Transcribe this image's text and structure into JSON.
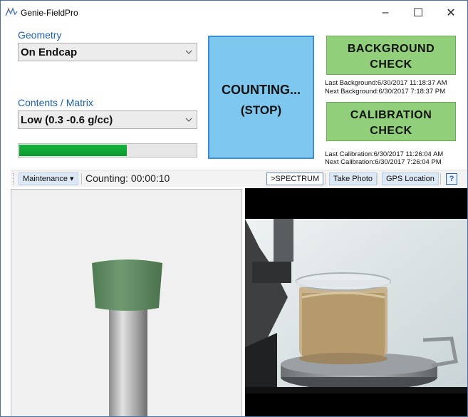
{
  "window": {
    "title": "Genie-FieldPro",
    "controls": {
      "minimize": "–",
      "maximize": "☐",
      "close": "✕"
    }
  },
  "left_controls": {
    "geometry_label": "Geometry",
    "geometry_value": "On Endcap",
    "contents_label": "Contents / Matrix",
    "contents_value": "Low (0.3 -0.6 g/cc)",
    "progress_fraction": 0.61
  },
  "counting_button": {
    "line1": "COUNTING...",
    "line2": "(STOP)"
  },
  "background_check": {
    "line1": "BACKGROUND",
    "line2": "CHECK",
    "last": "Last Background:6/30/2017 11:18:37 AM",
    "next": "Next Background:6/30/2017 7:18:37 PM"
  },
  "calibration_check": {
    "line1": "CALIBRATION",
    "line2": "CHECK",
    "last": "Last Calibration:6/30/2017 11:26:04 AM",
    "next": "Next Calibration:6/30/2017 7:26:04 PM"
  },
  "toolbar": {
    "maintenance": "Maintenance ▾",
    "counting_status": "Counting: 00:00:10",
    "spectrum": ">SPECTRUM",
    "take_photo": "Take Photo",
    "gps_location": "GPS Location",
    "help": "?"
  },
  "colors": {
    "counting_bg": "#7ec7ef",
    "check_bg": "#91cf7a",
    "progress": "#17b33e",
    "label_blue": "#1f5fa8",
    "endcap_green": "#5f8a60"
  },
  "icons": {
    "app": "genie-logo-icon",
    "combo": "chevron-down-icon",
    "help": "help-icon"
  }
}
